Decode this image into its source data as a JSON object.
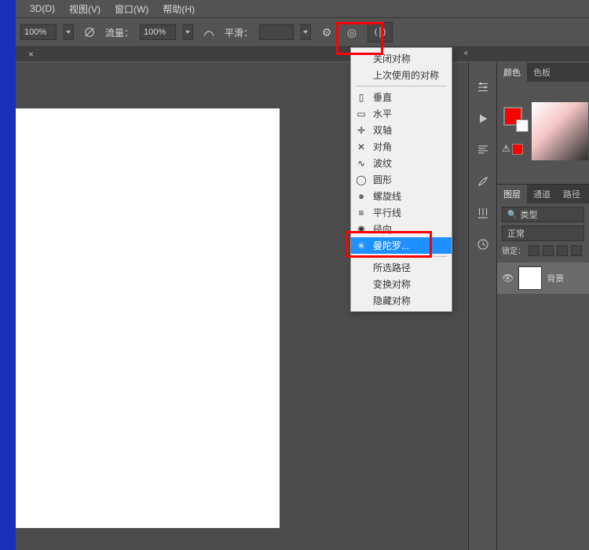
{
  "menubar": {
    "m3d": "3D(D)",
    "view": "视图(V)",
    "window": "窗口(W)",
    "help": "帮助(H)"
  },
  "options": {
    "opacity": "100%",
    "flow_label": "流量：",
    "flow": "100%",
    "smooth_label": "平滑："
  },
  "symmetry_menu": {
    "close": "关闭对称",
    "last": "上次使用的对称",
    "vertical": "垂直",
    "horizontal": "水平",
    "dual": "双轴",
    "diagonal": "对角",
    "wavy": "波纹",
    "circle": "圆形",
    "spiral": "螺旋线",
    "parallel": "平行线",
    "radial": "径向",
    "mandala": "曼陀罗...",
    "selpath": "所选路径",
    "transform": "变换对称",
    "hide": "隐藏对称"
  },
  "panels": {
    "color_tab": "颜色",
    "swatch_tab": "色板",
    "layers_tab": "图层",
    "channels_tab": "通道",
    "paths_tab": "路径",
    "type_label": "类型",
    "blend_mode": "正常",
    "lock_label": "锁定：",
    "layer_bg": "背景"
  }
}
